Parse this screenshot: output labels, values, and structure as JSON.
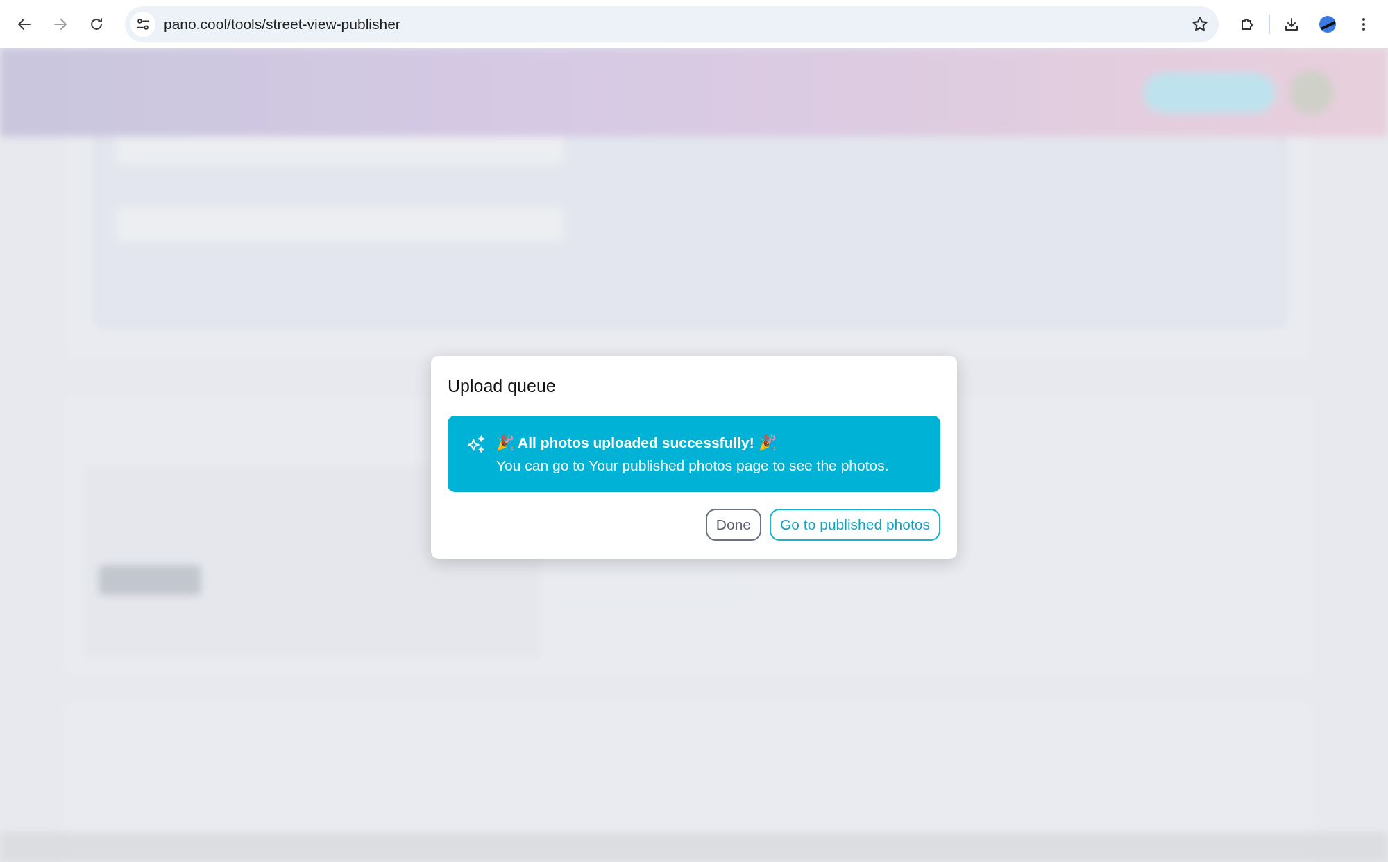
{
  "browser": {
    "url": "pano.cool/tools/street-view-publisher",
    "nav": [
      {
        "kind": "back",
        "disabled": false
      },
      {
        "kind": "forward",
        "disabled": true
      },
      {
        "kind": "reload",
        "disabled": false
      }
    ]
  },
  "dialog": {
    "title": "Upload queue",
    "alert": {
      "heading": "🎉 All photos uploaded successfully! 🎉",
      "message": "You can go to Your published photos page to see the photos."
    },
    "buttons": [
      {
        "label": "Done",
        "kind": "secondary"
      },
      {
        "label": "Go to published photos",
        "kind": "primary"
      }
    ]
  }
}
